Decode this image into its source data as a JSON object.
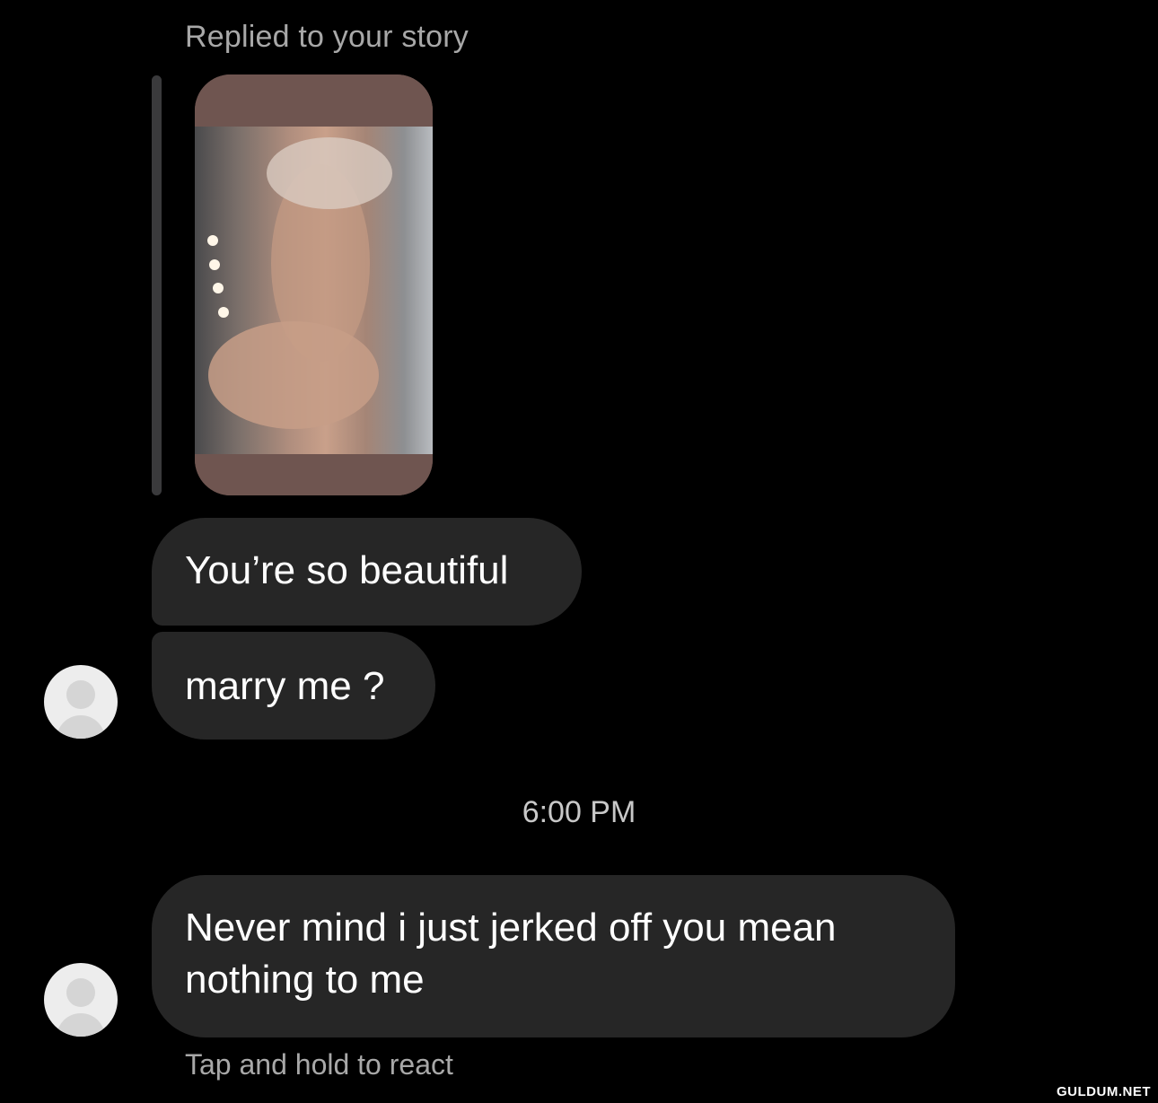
{
  "story_reply": {
    "caption": "Replied to your story"
  },
  "messages": [
    {
      "text": "You’re so beautiful"
    },
    {
      "text": "marry me ?"
    },
    {
      "text": "Never mind i just jerked off you mean nothing to me"
    }
  ],
  "timestamp": "6:00 PM",
  "hint": "Tap and hold to react",
  "watermark": "GULDUM.NET",
  "colors": {
    "background": "#000000",
    "bubble": "#262626",
    "secondary_text": "#a8a8a8",
    "avatar": "#ededed"
  },
  "icons": {
    "avatar": "default-avatar-icon"
  }
}
